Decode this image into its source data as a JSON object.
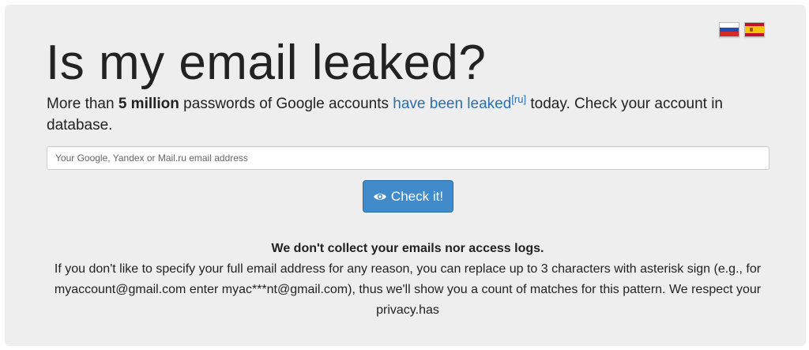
{
  "header": {
    "title": "Is my email leaked?",
    "languages": [
      {
        "code": "ru",
        "icon": "russia-flag-icon"
      },
      {
        "code": "es",
        "icon": "spain-flag-icon"
      }
    ]
  },
  "lead": {
    "prefix": "More than ",
    "count": "5 million",
    "middle": " passwords of Google accounts ",
    "link_text": "have been leaked",
    "link_sup": "[ru]",
    "suffix": " today. Check your account in database."
  },
  "search": {
    "placeholder": "Your Google, Yandex or Mail.ru email address",
    "value": ""
  },
  "check_button": {
    "label": "Check it!",
    "icon": "eye-icon"
  },
  "notice": {
    "headline": "We don't collect your emails nor access logs.",
    "body": "If you don't like to specify your full email address for any reason, you can replace up to 3 characters with asterisk sign (e.g., for myaccount@gmail.com enter myac***nt@gmail.com), thus we'll show you a count of matches for this pattern. We respect your privacy.has"
  },
  "colors": {
    "panel_background": "#eeeeee",
    "link": "#2a6fb0",
    "button_primary": "#428bca",
    "text": "#222222"
  }
}
